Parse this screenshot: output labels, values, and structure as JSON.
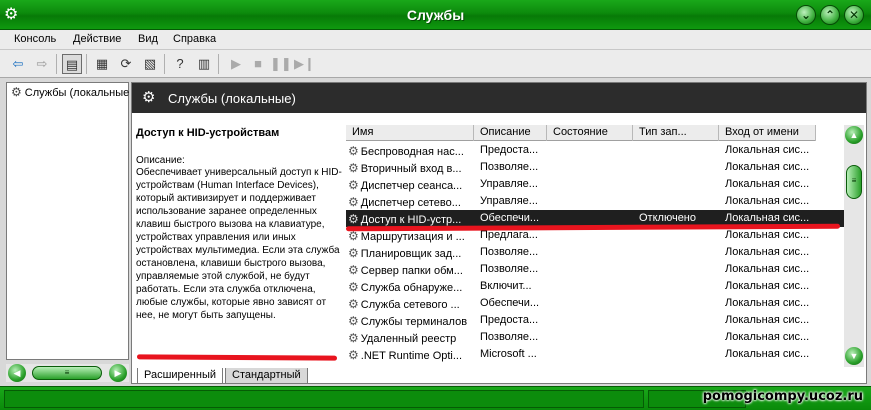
{
  "window": {
    "title": "Службы"
  },
  "menu": [
    "Консоль",
    "Действие",
    "Вид",
    "Справка"
  ],
  "tree": {
    "root_label": "Службы (локальные"
  },
  "pane": {
    "header": "Службы (локальные)"
  },
  "description": {
    "title": "Доступ к HID-устройствам",
    "label": "Описание:",
    "text": "Обеспечивает универсальный доступ к HID-устройствам (Human Interface Devices), который активизирует и поддерживает использование заранее определенных клавиш быстрого вызова на клавиатуре, устройствах управления или иных устройствах мультимедиа. Если эта служба остановлена, клавиши быстрого вызова, управляемые этой службой, не будут работать. Если эта служба отключена, любые службы, которые явно зависят от нее, не могут быть запущены."
  },
  "columns": [
    "Имя",
    "Описание",
    "Состояние",
    "Тип зап...",
    "Вход от имени"
  ],
  "services": [
    {
      "name": "Беспроводная нас...",
      "desc": "Предоста...",
      "state": "",
      "type": "",
      "logon": "Локальная сис..."
    },
    {
      "name": "Вторичный вход в...",
      "desc": "Позволяе...",
      "state": "",
      "type": "",
      "logon": "Локальная сис..."
    },
    {
      "name": "Диспетчер сеанса...",
      "desc": "Управляе...",
      "state": "",
      "type": "",
      "logon": "Локальная сис..."
    },
    {
      "name": "Диспетчер сетево...",
      "desc": "Управляе...",
      "state": "",
      "type": "",
      "logon": "Локальная сис..."
    },
    {
      "name": "Доступ к HID-устр...",
      "desc": "Обеспечи...",
      "state": "",
      "type": "Отключено",
      "logon": "Локальная сис...",
      "selected": true
    },
    {
      "name": "Маршрутизация и ...",
      "desc": "Предлага...",
      "state": "",
      "type": "",
      "logon": "Локальная сис..."
    },
    {
      "name": "Планировщик зад...",
      "desc": "Позволяе...",
      "state": "",
      "type": "",
      "logon": "Локальная сис..."
    },
    {
      "name": "Сервер папки обм...",
      "desc": "Позволяе...",
      "state": "",
      "type": "",
      "logon": "Локальная сис..."
    },
    {
      "name": "Служба обнаруже...",
      "desc": "Включит...",
      "state": "",
      "type": "",
      "logon": "Локальная сис..."
    },
    {
      "name": "Служба сетевого ...",
      "desc": "Обеспечи...",
      "state": "",
      "type": "",
      "logon": "Локальная сис..."
    },
    {
      "name": "Службы терминалов",
      "desc": "Предоста...",
      "state": "",
      "type": "",
      "logon": "Локальная сис..."
    },
    {
      "name": "Удаленный реестр",
      "desc": "Позволяе...",
      "state": "",
      "type": "",
      "logon": "Локальная сис..."
    },
    {
      "name": ".NET Runtime Opti...",
      "desc": "Microsoft ...",
      "state": "",
      "type": "",
      "logon": "Локальная сис..."
    }
  ],
  "tabs": [
    "Расширенный",
    "Стандартный"
  ],
  "watermark": "pomogicompy.ucoz.ru",
  "colors": {
    "accent": "#0c8a0c",
    "selection": "#1f1f1f",
    "annotation": "#e8141e"
  }
}
